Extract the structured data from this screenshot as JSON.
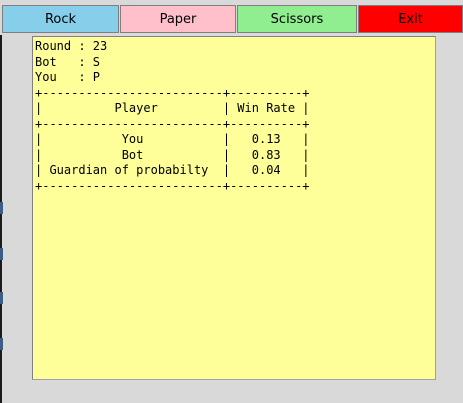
{
  "toolbar": {
    "rock_label": "Rock",
    "paper_label": "Paper",
    "scissors_label": "Scissors",
    "exit_label": "Exit"
  },
  "colors": {
    "rock": "#87ceeb",
    "paper": "#ffc0cb",
    "scissors": "#90ee90",
    "exit": "#ff0000",
    "output_background": "#ffff99",
    "window_background": "#d9d9d9"
  },
  "output": {
    "lines": [
      "Round : 23",
      "Bot   : S",
      "You   : P",
      "+-------------------------+----------+",
      "|          Player         | Win Rate |",
      "+-------------------------+----------+",
      "|           You           |   0.13   |",
      "|           Bot           |   0.83   |",
      "| Guardian of probabilty  |   0.04   |",
      "+-------------------------+----------+"
    ]
  }
}
